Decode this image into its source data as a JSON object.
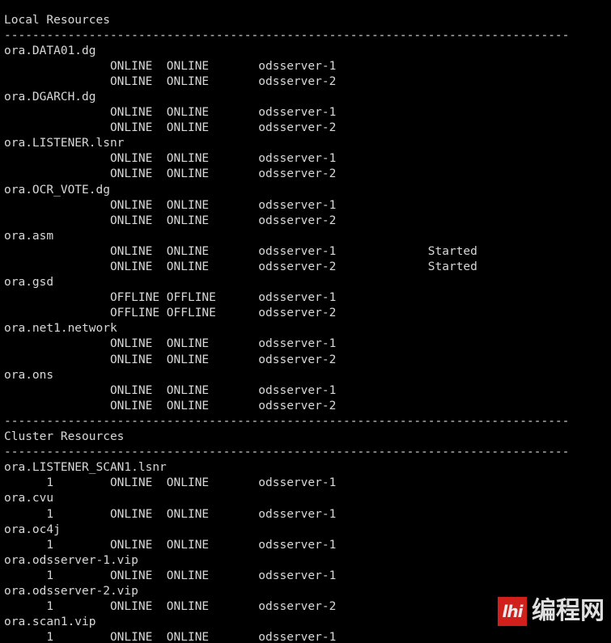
{
  "terminal": {
    "background_color": "#000000",
    "text_color": "#d8d8d8",
    "content": "Local Resources\n--------------------------------------------------------------------------------\nora.DATA01.dg\n               ONLINE  ONLINE       odsserver-1\n               ONLINE  ONLINE       odsserver-2\nora.DGARCH.dg\n               ONLINE  ONLINE       odsserver-1\n               ONLINE  ONLINE       odsserver-2\nora.LISTENER.lsnr\n               ONLINE  ONLINE       odsserver-1\n               ONLINE  ONLINE       odsserver-2\nora.OCR_VOTE.dg\n               ONLINE  ONLINE       odsserver-1\n               ONLINE  ONLINE       odsserver-2\nora.asm\n               ONLINE  ONLINE       odsserver-1             Started\n               ONLINE  ONLINE       odsserver-2             Started\nora.gsd\n               OFFLINE OFFLINE      odsserver-1\n               OFFLINE OFFLINE      odsserver-2\nora.net1.network\n               ONLINE  ONLINE       odsserver-1\n               ONLINE  ONLINE       odsserver-2\nora.ons\n               ONLINE  ONLINE       odsserver-1\n               ONLINE  ONLINE       odsserver-2\n--------------------------------------------------------------------------------\nCluster Resources\n--------------------------------------------------------------------------------\nora.LISTENER_SCAN1.lsnr\n      1        ONLINE  ONLINE       odsserver-1\nora.cvu\n      1        ONLINE  ONLINE       odsserver-1\nora.oc4j\n      1        ONLINE  ONLINE       odsserver-1\nora.odsserver-1.vip\n      1        ONLINE  ONLINE       odsserver-1\nora.odsserver-2.vip\n      1        ONLINE  ONLINE       odsserver-2\nora.scan1.vip\n      1        ONLINE  ONLINE       odsserver-1",
    "sections": [
      {
        "heading": "Local Resources",
        "separator": "--------------------------------------------------------------------------------",
        "resources": [
          {
            "name": "ora.DATA01.dg",
            "instances": [
              {
                "instance": "",
                "target": "ONLINE",
                "state": "ONLINE",
                "server": "odsserver-1",
                "state_details": ""
              },
              {
                "instance": "",
                "target": "ONLINE",
                "state": "ONLINE",
                "server": "odsserver-2",
                "state_details": ""
              }
            ]
          },
          {
            "name": "ora.DGARCH.dg",
            "instances": [
              {
                "instance": "",
                "target": "ONLINE",
                "state": "ONLINE",
                "server": "odsserver-1",
                "state_details": ""
              },
              {
                "instance": "",
                "target": "ONLINE",
                "state": "ONLINE",
                "server": "odsserver-2",
                "state_details": ""
              }
            ]
          },
          {
            "name": "ora.LISTENER.lsnr",
            "instances": [
              {
                "instance": "",
                "target": "ONLINE",
                "state": "ONLINE",
                "server": "odsserver-1",
                "state_details": ""
              },
              {
                "instance": "",
                "target": "ONLINE",
                "state": "ONLINE",
                "server": "odsserver-2",
                "state_details": ""
              }
            ]
          },
          {
            "name": "ora.OCR_VOTE.dg",
            "instances": [
              {
                "instance": "",
                "target": "ONLINE",
                "state": "ONLINE",
                "server": "odsserver-1",
                "state_details": ""
              },
              {
                "instance": "",
                "target": "ONLINE",
                "state": "ONLINE",
                "server": "odsserver-2",
                "state_details": ""
              }
            ]
          },
          {
            "name": "ora.asm",
            "instances": [
              {
                "instance": "",
                "target": "ONLINE",
                "state": "ONLINE",
                "server": "odsserver-1",
                "state_details": "Started"
              },
              {
                "instance": "",
                "target": "ONLINE",
                "state": "ONLINE",
                "server": "odsserver-2",
                "state_details": "Started"
              }
            ]
          },
          {
            "name": "ora.gsd",
            "instances": [
              {
                "instance": "",
                "target": "OFFLINE",
                "state": "OFFLINE",
                "server": "odsserver-1",
                "state_details": ""
              },
              {
                "instance": "",
                "target": "OFFLINE",
                "state": "OFFLINE",
                "server": "odsserver-2",
                "state_details": ""
              }
            ]
          },
          {
            "name": "ora.net1.network",
            "instances": [
              {
                "instance": "",
                "target": "ONLINE",
                "state": "ONLINE",
                "server": "odsserver-1",
                "state_details": ""
              },
              {
                "instance": "",
                "target": "ONLINE",
                "state": "ONLINE",
                "server": "odsserver-2",
                "state_details": ""
              }
            ]
          },
          {
            "name": "ora.ons",
            "instances": [
              {
                "instance": "",
                "target": "ONLINE",
                "state": "ONLINE",
                "server": "odsserver-1",
                "state_details": ""
              },
              {
                "instance": "",
                "target": "ONLINE",
                "state": "ONLINE",
                "server": "odsserver-2",
                "state_details": ""
              }
            ]
          }
        ]
      },
      {
        "heading": "Cluster Resources",
        "separator": "--------------------------------------------------------------------------------",
        "resources": [
          {
            "name": "ora.LISTENER_SCAN1.lsnr",
            "instances": [
              {
                "instance": "1",
                "target": "ONLINE",
                "state": "ONLINE",
                "server": "odsserver-1",
                "state_details": ""
              }
            ]
          },
          {
            "name": "ora.cvu",
            "instances": [
              {
                "instance": "1",
                "target": "ONLINE",
                "state": "ONLINE",
                "server": "odsserver-1",
                "state_details": ""
              }
            ]
          },
          {
            "name": "ora.oc4j",
            "instances": [
              {
                "instance": "1",
                "target": "ONLINE",
                "state": "ONLINE",
                "server": "odsserver-1",
                "state_details": ""
              }
            ]
          },
          {
            "name": "ora.odsserver-1.vip",
            "instances": [
              {
                "instance": "1",
                "target": "ONLINE",
                "state": "ONLINE",
                "server": "odsserver-1",
                "state_details": ""
              }
            ]
          },
          {
            "name": "ora.odsserver-2.vip",
            "instances": [
              {
                "instance": "1",
                "target": "ONLINE",
                "state": "ONLINE",
                "server": "odsserver-2",
                "state_details": ""
              }
            ]
          },
          {
            "name": "ora.scan1.vip",
            "instances": [
              {
                "instance": "1",
                "target": "ONLINE",
                "state": "ONLINE",
                "server": "odsserver-1",
                "state_details": ""
              }
            ]
          }
        ]
      }
    ]
  },
  "watermark": {
    "logo_text": "lhi",
    "site_name": "编程网",
    "logo_color": "#e3221f",
    "text_color": "#f2f2f2"
  }
}
